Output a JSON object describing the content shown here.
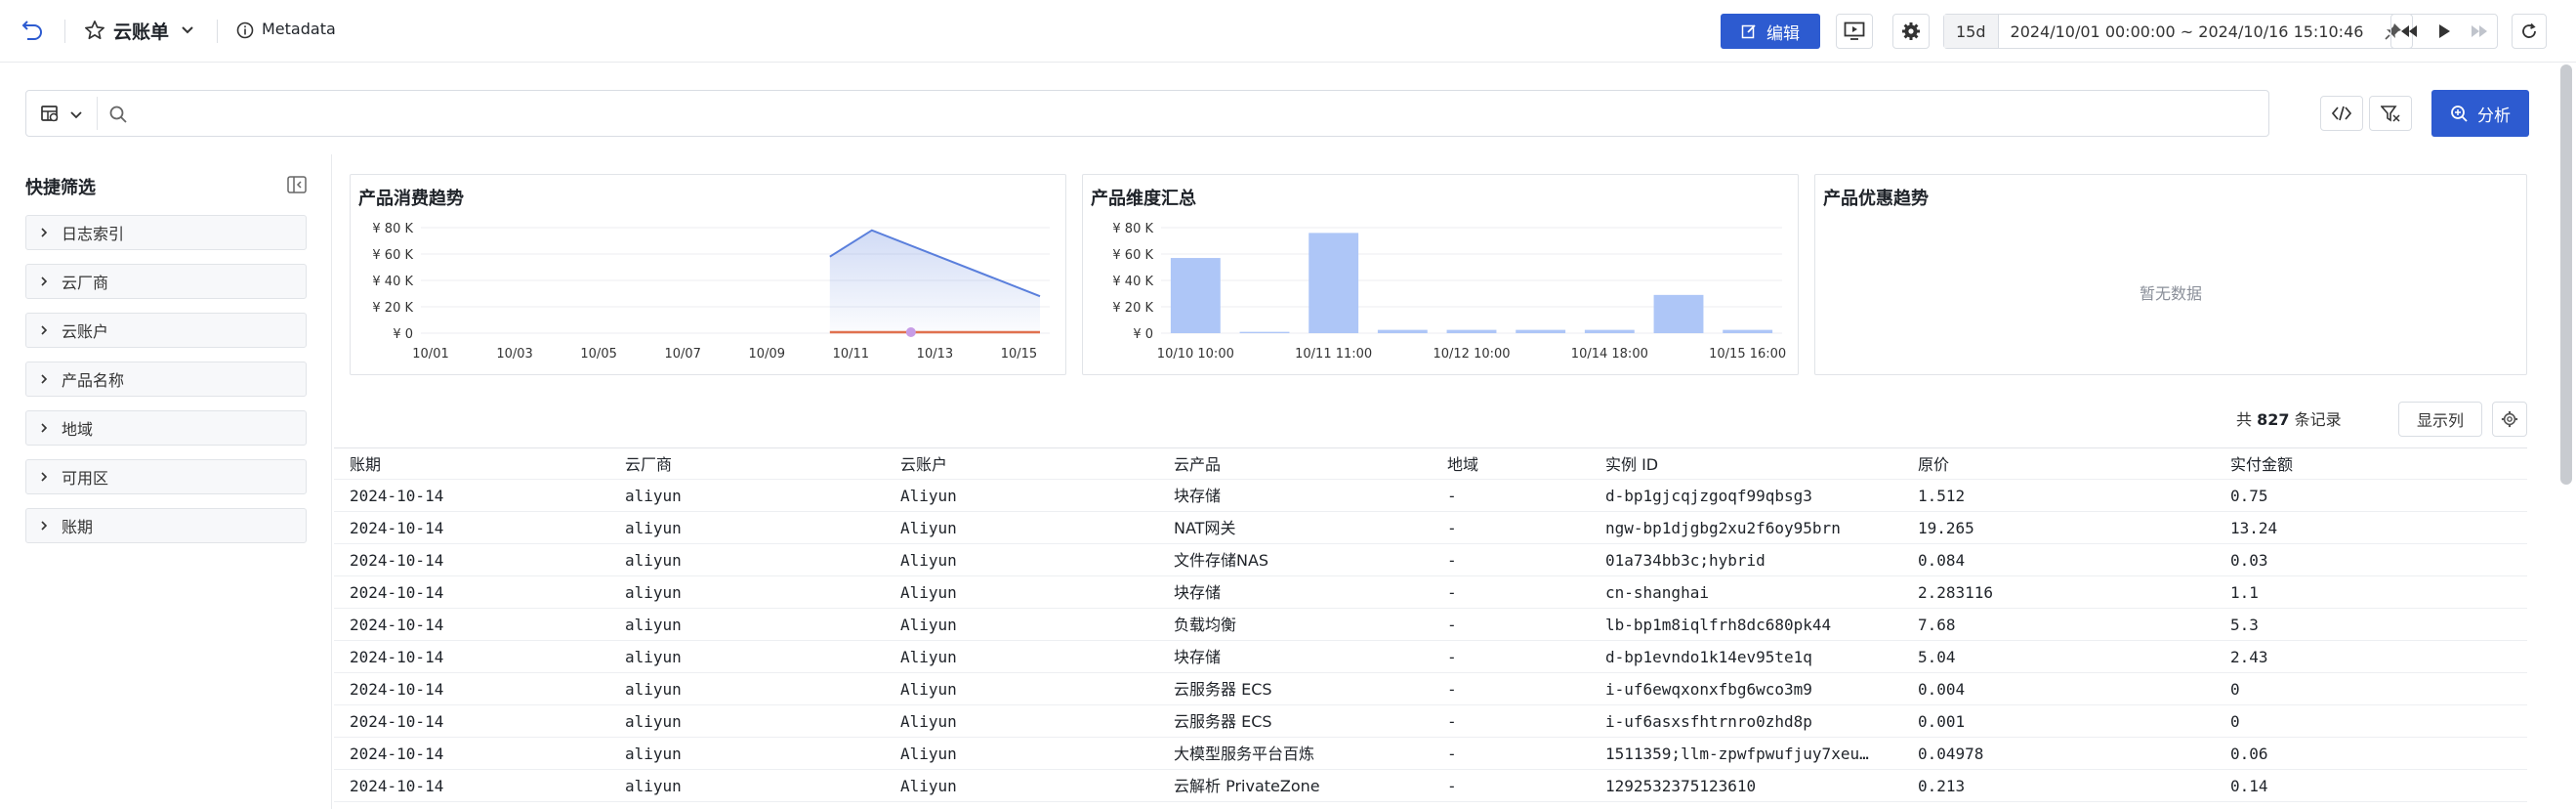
{
  "header": {
    "title": "云账单",
    "metadata_label": "Metadata",
    "edit_label": "编辑",
    "time_preset": "15d",
    "time_range": "2024/10/01 00:00:00 ~ 2024/10/16 15:10:46"
  },
  "query": {
    "placeholder": "",
    "analyze_label": "分析"
  },
  "sidebar": {
    "title": "快捷筛选",
    "items": [
      {
        "label": "日志索引"
      },
      {
        "label": "云厂商"
      },
      {
        "label": "云账户"
      },
      {
        "label": "产品名称"
      },
      {
        "label": "地域"
      },
      {
        "label": "可用区"
      },
      {
        "label": "账期"
      }
    ]
  },
  "panels": {
    "trend_title": "产品消费趋势",
    "dimension_title": "产品维度汇总",
    "discount_title": "产品优惠趋势",
    "no_data": "暂无数据"
  },
  "chart_data": [
    {
      "type": "line",
      "title": "产品消费趋势",
      "y_ticks": [
        "¥ 80 K",
        "¥ 60 K",
        "¥ 40 K",
        "¥ 20 K",
        "¥ 0"
      ],
      "ylim": [
        0,
        80000
      ],
      "x_ticks": [
        "10/01",
        "10/03",
        "10/05",
        "10/07",
        "10/09",
        "10/11",
        "10/13",
        "10/15"
      ],
      "x": [
        "10/10 12:00",
        "10/11 12:00",
        "10/15 12:00"
      ],
      "series": [
        {
          "values": [
            58000,
            78000,
            28000
          ],
          "color": "#5a7fdc"
        },
        {
          "values": [
            0,
            0,
            0
          ],
          "color": "#e0714f"
        }
      ],
      "marker_at": "10/11 12:00",
      "colors": {
        "area_top": "#5a7fdc",
        "marker": "#c79ce6"
      }
    },
    {
      "type": "bar",
      "title": "产品维度汇总",
      "y_ticks": [
        "¥ 80 K",
        "¥ 60 K",
        "¥ 40 K",
        "¥ 20 K",
        "¥ 0"
      ],
      "ylim": [
        0,
        80000
      ],
      "x_ticks": [
        "10/10 10:00",
        "10/11 11:00",
        "10/12 10:00",
        "10/14 18:00",
        "10/15 16:00"
      ],
      "values": [
        57000,
        1000,
        76000,
        2500,
        2500,
        2500,
        2500,
        29000,
        2500
      ],
      "color": "#aec6f7"
    }
  ],
  "table": {
    "total_prefix": "共",
    "total_count": "827",
    "total_suffix": "条记录",
    "show_columns_label": "显示列",
    "columns": [
      "账期",
      "云厂商",
      "云账户",
      "云产品",
      "地域",
      "实例 ID",
      "原价",
      "实付金额"
    ],
    "rows": [
      [
        "2024-10-14",
        "aliyun",
        "Aliyun",
        "块存储",
        "-",
        "d-bp1gjcqjzgoqf99qbsg3",
        "1.512",
        "0.75"
      ],
      [
        "2024-10-14",
        "aliyun",
        "Aliyun",
        "NAT网关",
        "-",
        "ngw-bp1djgbg2xu2f6oy95brn",
        "19.265",
        "13.24"
      ],
      [
        "2024-10-14",
        "aliyun",
        "Aliyun",
        "文件存储NAS",
        "-",
        "01a734bb3c;hybrid",
        "0.084",
        "0.03"
      ],
      [
        "2024-10-14",
        "aliyun",
        "Aliyun",
        "块存储",
        "-",
        "cn-shanghai",
        "2.283116",
        "1.1"
      ],
      [
        "2024-10-14",
        "aliyun",
        "Aliyun",
        "负载均衡",
        "-",
        "lb-bp1m8iqlfrh8dc680pk44",
        "7.68",
        "5.3"
      ],
      [
        "2024-10-14",
        "aliyun",
        "Aliyun",
        "块存储",
        "-",
        "d-bp1evndo1k14ev95te1q",
        "5.04",
        "2.43"
      ],
      [
        "2024-10-14",
        "aliyun",
        "Aliyun",
        "云服务器 ECS",
        "-",
        "i-uf6ewqxonxfbg6wco3m9",
        "0.004",
        "0"
      ],
      [
        "2024-10-14",
        "aliyun",
        "Aliyun",
        "云服务器 ECS",
        "-",
        "i-uf6asxsfhtrnro0zhd8p",
        "0.001",
        "0"
      ],
      [
        "2024-10-14",
        "aliyun",
        "Aliyun",
        "大模型服务平台百炼",
        "-",
        "1511359;llm-zpwfpwufjuy7xeu…",
        "0.04978",
        "0.06"
      ],
      [
        "2024-10-14",
        "aliyun",
        "Aliyun",
        "云解析 PrivateZone",
        "-",
        "1292532375123610",
        "0.213",
        "0.14"
      ]
    ]
  }
}
